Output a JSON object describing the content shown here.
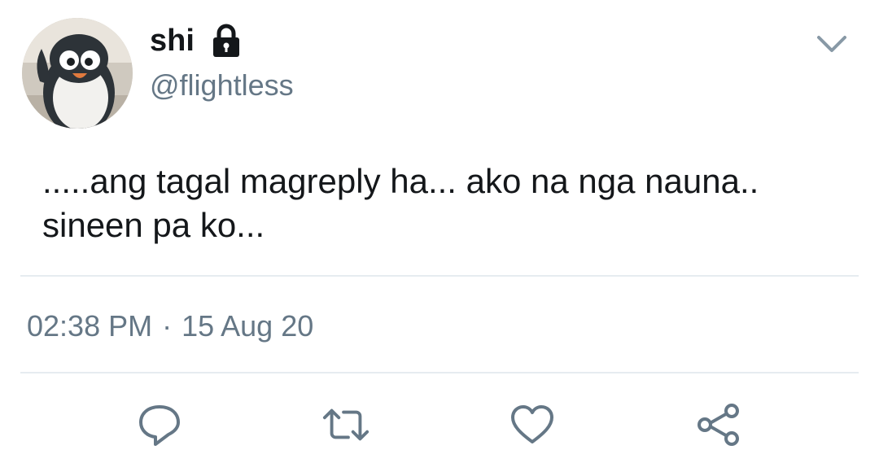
{
  "tweet": {
    "author": {
      "display_name": "shi",
      "handle": "@flightless",
      "protected_icon": "lock-icon",
      "avatar": "penguin-avatar"
    },
    "menu_icon": "chevron-down-icon",
    "text": ".....ang tagal magreply ha... ako na nga nauna..\nsineen pa ko...",
    "time": "02:38 PM",
    "separator": "·",
    "date": "15 Aug 20",
    "actions": [
      {
        "name": "reply",
        "icon": "reply-icon"
      },
      {
        "name": "retweet",
        "icon": "retweet-icon"
      },
      {
        "name": "like",
        "icon": "heart-icon"
      },
      {
        "name": "share",
        "icon": "share-icon"
      }
    ],
    "colors": {
      "text": "#14171a",
      "secondary": "#657786",
      "divider": "#e6ecf0"
    }
  }
}
